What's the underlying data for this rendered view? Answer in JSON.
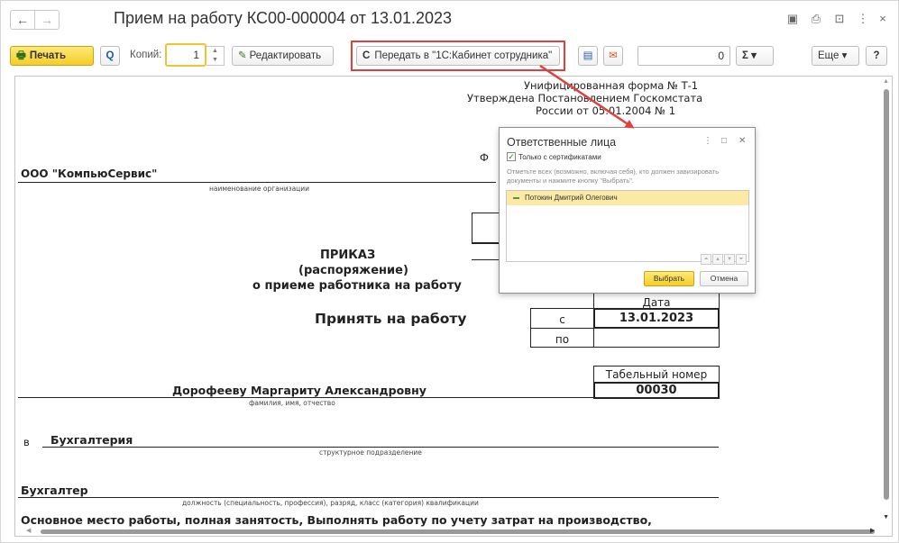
{
  "window": {
    "title": "Прием на работу КС00-000004 от 13.01.2023",
    "nav_back": "←",
    "nav_forward": "→",
    "controls": [
      "💾",
      "🖨",
      "🔍",
      "⋮",
      "×"
    ]
  },
  "toolbar": {
    "print_label": "Печать",
    "preview_icon": "Q",
    "copies_label": "Копий:",
    "copies_value": "1",
    "edit_label": "Редактировать",
    "send_label": "Передать в \"1С:Кабинет сотрудника\"",
    "send_icon": "C",
    "number_value": "0",
    "sum_label": "Σ ▾",
    "more_label": "Еще ▾",
    "help_label": "?"
  },
  "document": {
    "header_line1": "Унифицированная форма № Т-1",
    "header_line2": "Утверждена Постановлением Госкомстата",
    "header_line3": "России от 05.01.2004 № 1",
    "org_name": "ООО \"КомпьюСервис\"",
    "org_caption": "наименование организации",
    "f_fragment": "Ф",
    "order_title": "ПРИКАЗ",
    "order_subtitle": "(распоряжение)",
    "order_about": "о приеме работника на работу",
    "action": "Принять на работу",
    "date_header": "Дата",
    "from_label": "с",
    "from_date": "13.01.2023",
    "to_label": "по",
    "tabnum_header": "Табельный номер",
    "tabnum_value": "00030",
    "employee_name": "Дорофееву Маргариту Александровну",
    "employee_caption": "фамилия, имя, отчество",
    "dept_prefix": "в",
    "department": "Бухгалтерия",
    "dept_caption": "структурное подразделение",
    "position": "Бухгалтер",
    "position_caption": "должность (специальность, профессия), разряд, класс (категория) квалификации",
    "work_terms": "Основное место работы, полная занятость, Выполнять работу по учету затрат на производство,"
  },
  "popup": {
    "title": "Ответственные лица",
    "checkbox_label": "Только с сертификатами",
    "hint": "Отметьте всех (возможно, включая себя), кто должен завизировать документы и нажмите кнопку \"Выбрать\".",
    "list_items": [
      "Потокин Дмитрий Олегович"
    ],
    "choose_label": "Выбрать",
    "cancel_label": "Отмена"
  },
  "colors": {
    "accent_yellow": "#f5cd27",
    "highlight_red": "#e1403c",
    "selection": "#fbeaa5"
  }
}
